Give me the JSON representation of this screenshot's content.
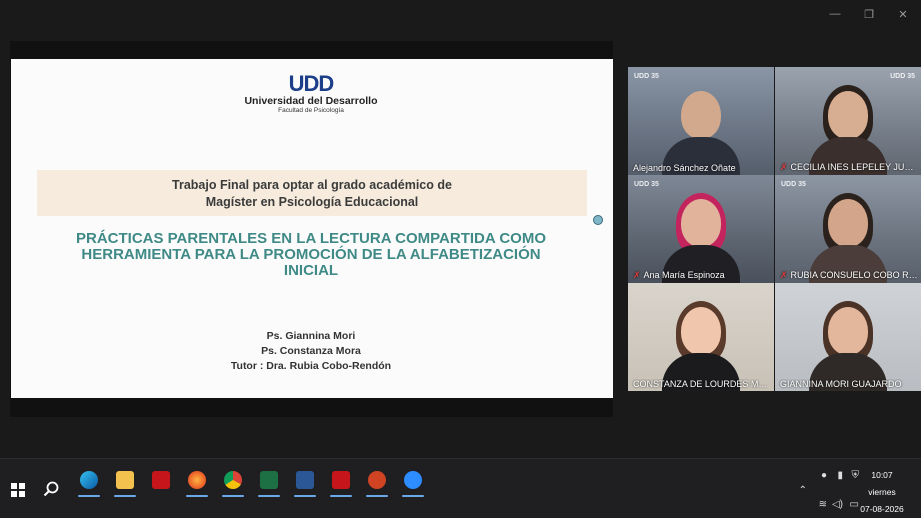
{
  "slide": {
    "logo_mark": "UDD",
    "logo_name": "Universidad del Desarrollo",
    "logo_sub": "Facultad de Psicología",
    "band_line1": "Trabajo Final para optar al grado académico de",
    "band_line2": "Magíster en Psicología Educacional",
    "title_line1": "PRÁCTICAS PARENTALES EN LA LECTURA COMPARTIDA COMO",
    "title_line2": "HERRAMIENTA PARA LA PROMOCIÓN DE LA ALFABETIZACIÓN",
    "title_line3": "INICIAL",
    "author1": "Ps. Giannina Mori",
    "author2": "Ps. Constanza Mora",
    "tutor": "Tutor : Dra. Rubia Cobo-Rendón"
  },
  "participants": [
    {
      "name": "Alejandro Sánchez Oñate",
      "muted": false
    },
    {
      "name": "CECILIA INES LEPELEY JUNGJOHANN",
      "muted": true
    },
    {
      "name": "Ana María Espinoza",
      "muted": true
    },
    {
      "name": "RUBIA CONSUELO COBO RENDÓN",
      "muted": true
    },
    {
      "name": "CONSTANZA DE LOURDES MORA ARRIAGADA",
      "muted": false
    },
    {
      "name": "GIANNINA MORI GUAJARDO",
      "muted": false
    }
  ],
  "tile_logo": "UDD  35",
  "taskbar": {
    "apps": [
      "edge-icon",
      "file-explorer-icon",
      "acrobat-icon",
      "firefox-icon",
      "chrome-icon",
      "excel-icon",
      "word-icon",
      "acrobat-icon",
      "powerpoint-icon",
      "zoom-icon"
    ]
  },
  "clock": {
    "time": "10:07",
    "day": "viernes",
    "date": "07-08-2026"
  },
  "colors": {
    "accent_title": "#3f8a86",
    "active_speaker": "#2fd17a",
    "muted": "#e23b3b"
  }
}
